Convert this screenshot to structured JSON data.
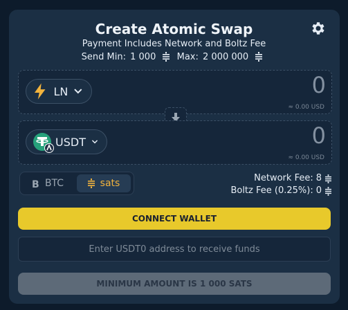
{
  "header": {
    "title": "Create Atomic Swap",
    "subtitle": "Payment Includes Network and Boltz Fee",
    "send_min_label": "Send Min:",
    "send_min_value": "1 000",
    "max_label": "Max:",
    "max_value": "2 000 000"
  },
  "send": {
    "asset": "LN",
    "amount": "0",
    "usd": "≈ 0.00 USD"
  },
  "receive": {
    "asset": "USDT",
    "amount": "0",
    "usd": "≈ 0.00 USD"
  },
  "units": {
    "btc_label": "BTC",
    "sats_label": "sats",
    "selected": "sats"
  },
  "fees": {
    "network_label": "Network Fee:",
    "network_value": "8",
    "boltz_label": "Boltz Fee (0.25%):",
    "boltz_value": "0"
  },
  "actions": {
    "connect_label": "CONNECT WALLET",
    "address_placeholder": "Enter USDT0 address to receive funds",
    "submit_label": "MINIMUM AMOUNT IS 1 000 SATS"
  },
  "colors": {
    "accent_yellow": "#e8c92b",
    "sats_orange": "#f2b33d",
    "tether_green": "#26a17b",
    "background": "#0d1b2b",
    "card": "#1b2f44"
  }
}
